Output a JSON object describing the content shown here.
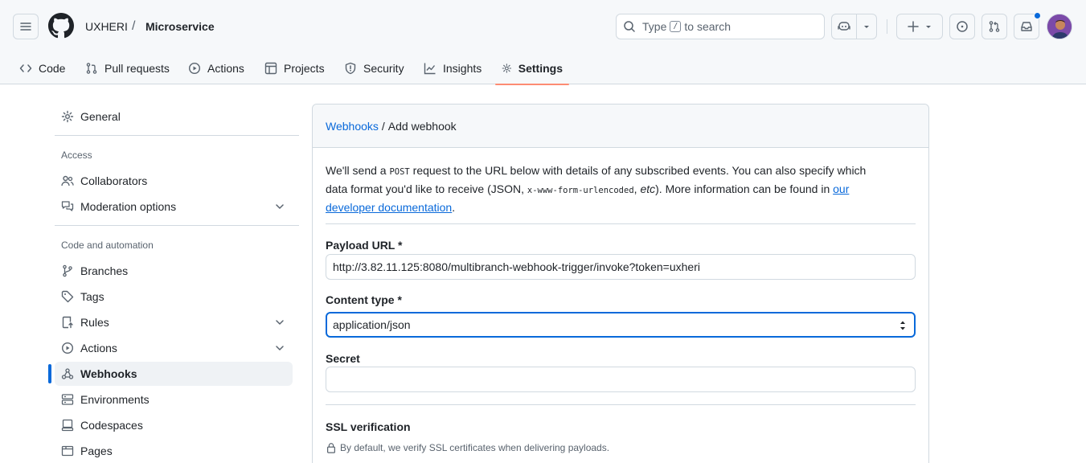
{
  "header": {
    "owner": "UXHERI",
    "separator": "/",
    "repo": "Microservice",
    "search": {
      "prefix": "Type",
      "key": "/",
      "suffix": "to search"
    }
  },
  "tabs": [
    {
      "label": "Code",
      "icon": "code-icon"
    },
    {
      "label": "Pull requests",
      "icon": "git-pull-request-icon"
    },
    {
      "label": "Actions",
      "icon": "play-icon"
    },
    {
      "label": "Projects",
      "icon": "table-icon"
    },
    {
      "label": "Security",
      "icon": "shield-icon"
    },
    {
      "label": "Insights",
      "icon": "graph-icon"
    },
    {
      "label": "Settings",
      "icon": "gear-icon",
      "active": true
    }
  ],
  "sidebar": {
    "general": "General",
    "access_heading": "Access",
    "collaborators": "Collaborators",
    "moderation": "Moderation options",
    "code_heading": "Code and automation",
    "branches": "Branches",
    "tags": "Tags",
    "rules": "Rules",
    "actions": "Actions",
    "webhooks": "Webhooks",
    "environments": "Environments",
    "codespaces": "Codespaces",
    "pages": "Pages"
  },
  "panel": {
    "breadcrumb_link": "Webhooks",
    "breadcrumb_sep": "/",
    "breadcrumb_current": "Add webhook",
    "intro": {
      "p1": "We'll send a ",
      "code1": "POST",
      "p2": " request to the URL below with details of any subscribed events. You can also specify which data format you'd like to receive (JSON, ",
      "code2": "x-www-form-urlencoded",
      "p3": ", ",
      "etc": "etc",
      "p4": "). More information can be found in ",
      "link": "our developer documentation",
      "p5": "."
    },
    "payload_label": "Payload URL *",
    "payload_value": "http://3.82.11.125:8080/multibranch-webhook-trigger/invoke?token=uxheri",
    "content_type_label": "Content type *",
    "content_type_value": "application/json",
    "secret_label": "Secret",
    "secret_value": "",
    "ssl_label": "SSL verification",
    "ssl_note": "By default, we verify SSL certificates when delivering payloads."
  }
}
